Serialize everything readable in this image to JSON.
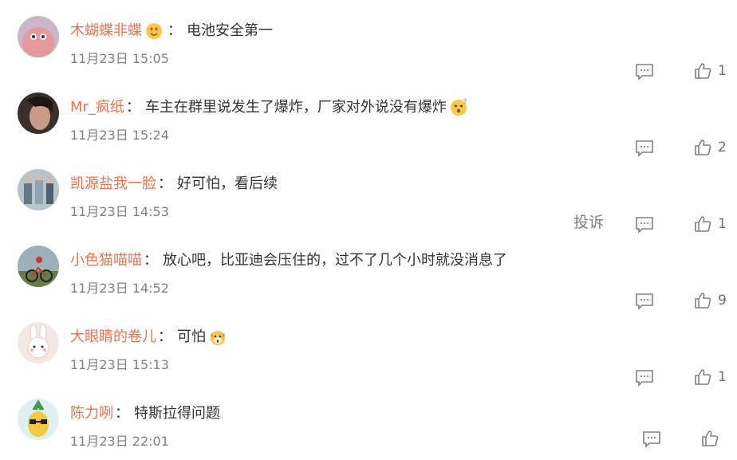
{
  "comments": [
    {
      "username": "木蝴蝶非蝶",
      "badge_icon": "heart-eyes-emoji-icon",
      "text": "电池安全第一",
      "time": "11月23日 15:05",
      "likes": "1"
    },
    {
      "username": "Mr_疯纸",
      "text": "车主在群里说发生了爆炸，厂家对外说没有爆炸",
      "trailing_emoji": "thinking-face-emoji-icon",
      "time": "11月23日 15:24",
      "likes": "2"
    },
    {
      "username": "凯源盐我一脸",
      "text": "好可怕，看后续",
      "time": "11月23日 14:53",
      "likes": "1",
      "report_label": "投诉"
    },
    {
      "username": "小色猫喵喵",
      "text": "放心吧，比亚迪会压住的，过不了几个小时就没消息了",
      "time": "11月23日 14:52",
      "likes": "9"
    },
    {
      "username": "大眼睛的卷儿",
      "text": "可怕",
      "trailing_emoji": "scared-dog-emoji-icon",
      "time": "11月23日 15:13",
      "likes": "1"
    },
    {
      "username": "陈力咧",
      "text": "特斯拉得问题",
      "time": "11月23日 22:01",
      "likes": ""
    }
  ],
  "separator": "：",
  "colors": {
    "username": "#eb7350",
    "text": "#333333",
    "meta": "#808080"
  }
}
